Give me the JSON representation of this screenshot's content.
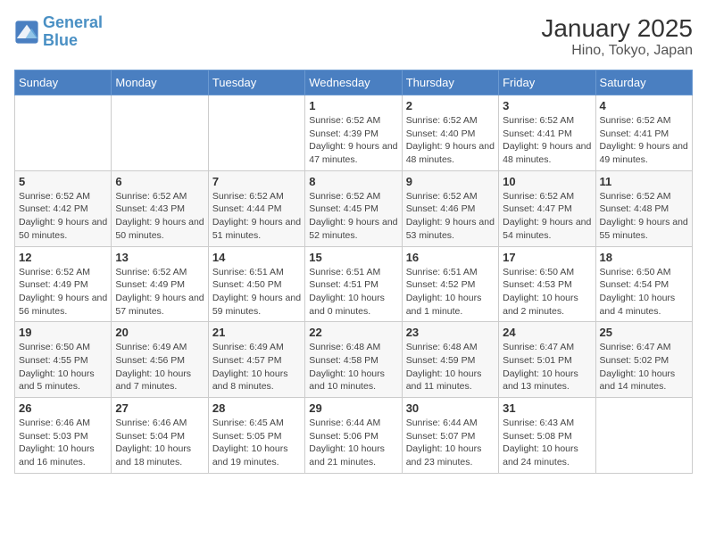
{
  "logo": {
    "line1": "General",
    "line2": "Blue"
  },
  "title": "January 2025",
  "subtitle": "Hino, Tokyo, Japan",
  "weekdays": [
    "Sunday",
    "Monday",
    "Tuesday",
    "Wednesday",
    "Thursday",
    "Friday",
    "Saturday"
  ],
  "weeks": [
    [
      {
        "day": "",
        "info": ""
      },
      {
        "day": "",
        "info": ""
      },
      {
        "day": "",
        "info": ""
      },
      {
        "day": "1",
        "info": "Sunrise: 6:52 AM\nSunset: 4:39 PM\nDaylight: 9 hours and 47 minutes."
      },
      {
        "day": "2",
        "info": "Sunrise: 6:52 AM\nSunset: 4:40 PM\nDaylight: 9 hours and 48 minutes."
      },
      {
        "day": "3",
        "info": "Sunrise: 6:52 AM\nSunset: 4:41 PM\nDaylight: 9 hours and 48 minutes."
      },
      {
        "day": "4",
        "info": "Sunrise: 6:52 AM\nSunset: 4:41 PM\nDaylight: 9 hours and 49 minutes."
      }
    ],
    [
      {
        "day": "5",
        "info": "Sunrise: 6:52 AM\nSunset: 4:42 PM\nDaylight: 9 hours and 50 minutes."
      },
      {
        "day": "6",
        "info": "Sunrise: 6:52 AM\nSunset: 4:43 PM\nDaylight: 9 hours and 50 minutes."
      },
      {
        "day": "7",
        "info": "Sunrise: 6:52 AM\nSunset: 4:44 PM\nDaylight: 9 hours and 51 minutes."
      },
      {
        "day": "8",
        "info": "Sunrise: 6:52 AM\nSunset: 4:45 PM\nDaylight: 9 hours and 52 minutes."
      },
      {
        "day": "9",
        "info": "Sunrise: 6:52 AM\nSunset: 4:46 PM\nDaylight: 9 hours and 53 minutes."
      },
      {
        "day": "10",
        "info": "Sunrise: 6:52 AM\nSunset: 4:47 PM\nDaylight: 9 hours and 54 minutes."
      },
      {
        "day": "11",
        "info": "Sunrise: 6:52 AM\nSunset: 4:48 PM\nDaylight: 9 hours and 55 minutes."
      }
    ],
    [
      {
        "day": "12",
        "info": "Sunrise: 6:52 AM\nSunset: 4:49 PM\nDaylight: 9 hours and 56 minutes."
      },
      {
        "day": "13",
        "info": "Sunrise: 6:52 AM\nSunset: 4:49 PM\nDaylight: 9 hours and 57 minutes."
      },
      {
        "day": "14",
        "info": "Sunrise: 6:51 AM\nSunset: 4:50 PM\nDaylight: 9 hours and 59 minutes."
      },
      {
        "day": "15",
        "info": "Sunrise: 6:51 AM\nSunset: 4:51 PM\nDaylight: 10 hours and 0 minutes."
      },
      {
        "day": "16",
        "info": "Sunrise: 6:51 AM\nSunset: 4:52 PM\nDaylight: 10 hours and 1 minute."
      },
      {
        "day": "17",
        "info": "Sunrise: 6:50 AM\nSunset: 4:53 PM\nDaylight: 10 hours and 2 minutes."
      },
      {
        "day": "18",
        "info": "Sunrise: 6:50 AM\nSunset: 4:54 PM\nDaylight: 10 hours and 4 minutes."
      }
    ],
    [
      {
        "day": "19",
        "info": "Sunrise: 6:50 AM\nSunset: 4:55 PM\nDaylight: 10 hours and 5 minutes."
      },
      {
        "day": "20",
        "info": "Sunrise: 6:49 AM\nSunset: 4:56 PM\nDaylight: 10 hours and 7 minutes."
      },
      {
        "day": "21",
        "info": "Sunrise: 6:49 AM\nSunset: 4:57 PM\nDaylight: 10 hours and 8 minutes."
      },
      {
        "day": "22",
        "info": "Sunrise: 6:48 AM\nSunset: 4:58 PM\nDaylight: 10 hours and 10 minutes."
      },
      {
        "day": "23",
        "info": "Sunrise: 6:48 AM\nSunset: 4:59 PM\nDaylight: 10 hours and 11 minutes."
      },
      {
        "day": "24",
        "info": "Sunrise: 6:47 AM\nSunset: 5:01 PM\nDaylight: 10 hours and 13 minutes."
      },
      {
        "day": "25",
        "info": "Sunrise: 6:47 AM\nSunset: 5:02 PM\nDaylight: 10 hours and 14 minutes."
      }
    ],
    [
      {
        "day": "26",
        "info": "Sunrise: 6:46 AM\nSunset: 5:03 PM\nDaylight: 10 hours and 16 minutes."
      },
      {
        "day": "27",
        "info": "Sunrise: 6:46 AM\nSunset: 5:04 PM\nDaylight: 10 hours and 18 minutes."
      },
      {
        "day": "28",
        "info": "Sunrise: 6:45 AM\nSunset: 5:05 PM\nDaylight: 10 hours and 19 minutes."
      },
      {
        "day": "29",
        "info": "Sunrise: 6:44 AM\nSunset: 5:06 PM\nDaylight: 10 hours and 21 minutes."
      },
      {
        "day": "30",
        "info": "Sunrise: 6:44 AM\nSunset: 5:07 PM\nDaylight: 10 hours and 23 minutes."
      },
      {
        "day": "31",
        "info": "Sunrise: 6:43 AM\nSunset: 5:08 PM\nDaylight: 10 hours and 24 minutes."
      },
      {
        "day": "",
        "info": ""
      }
    ]
  ]
}
